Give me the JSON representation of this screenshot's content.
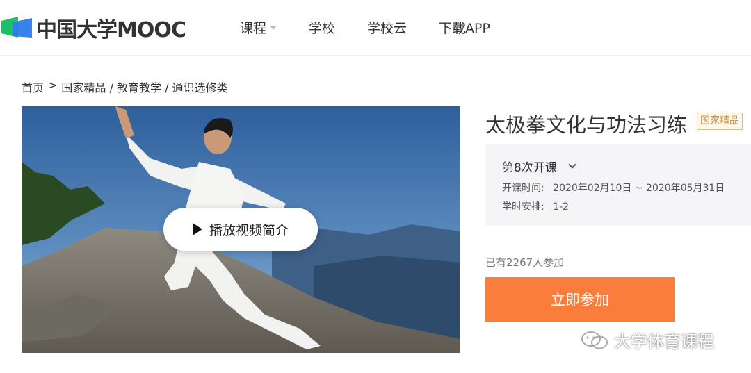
{
  "header": {
    "logo_text": "中国大学MOOC",
    "nav": [
      {
        "label": "课程",
        "has_dropdown": true
      },
      {
        "label": "学校",
        "has_dropdown": false
      },
      {
        "label": "学校云",
        "has_dropdown": false
      },
      {
        "label": "下载APP",
        "has_dropdown": false
      }
    ]
  },
  "breadcrumb": {
    "home": "首页",
    "separator": ">",
    "path": "国家精品 / 教育教学 / 通识选修类"
  },
  "video": {
    "play_label": "播放视频简介"
  },
  "course": {
    "title": "太极拳文化与功法习练",
    "badge": "国家精品",
    "term": "第8次开课",
    "time_label": "开课时间:",
    "time_value": "2020年02月10日 ~ 2020年05月31日",
    "hours_label": "学时安排:",
    "hours_value": "1-2",
    "enrolled": "已有2267人参加",
    "join_label": "立即参加"
  },
  "watermark": {
    "text": "大学体育课程"
  },
  "colors": {
    "accent": "#fa7d3c",
    "badge_border": "#e7b97f",
    "badge_text": "#d38f3a",
    "info_bg": "#f5f5f7",
    "logo_green": "#1fbf6a",
    "logo_blue": "#2b7de9"
  }
}
